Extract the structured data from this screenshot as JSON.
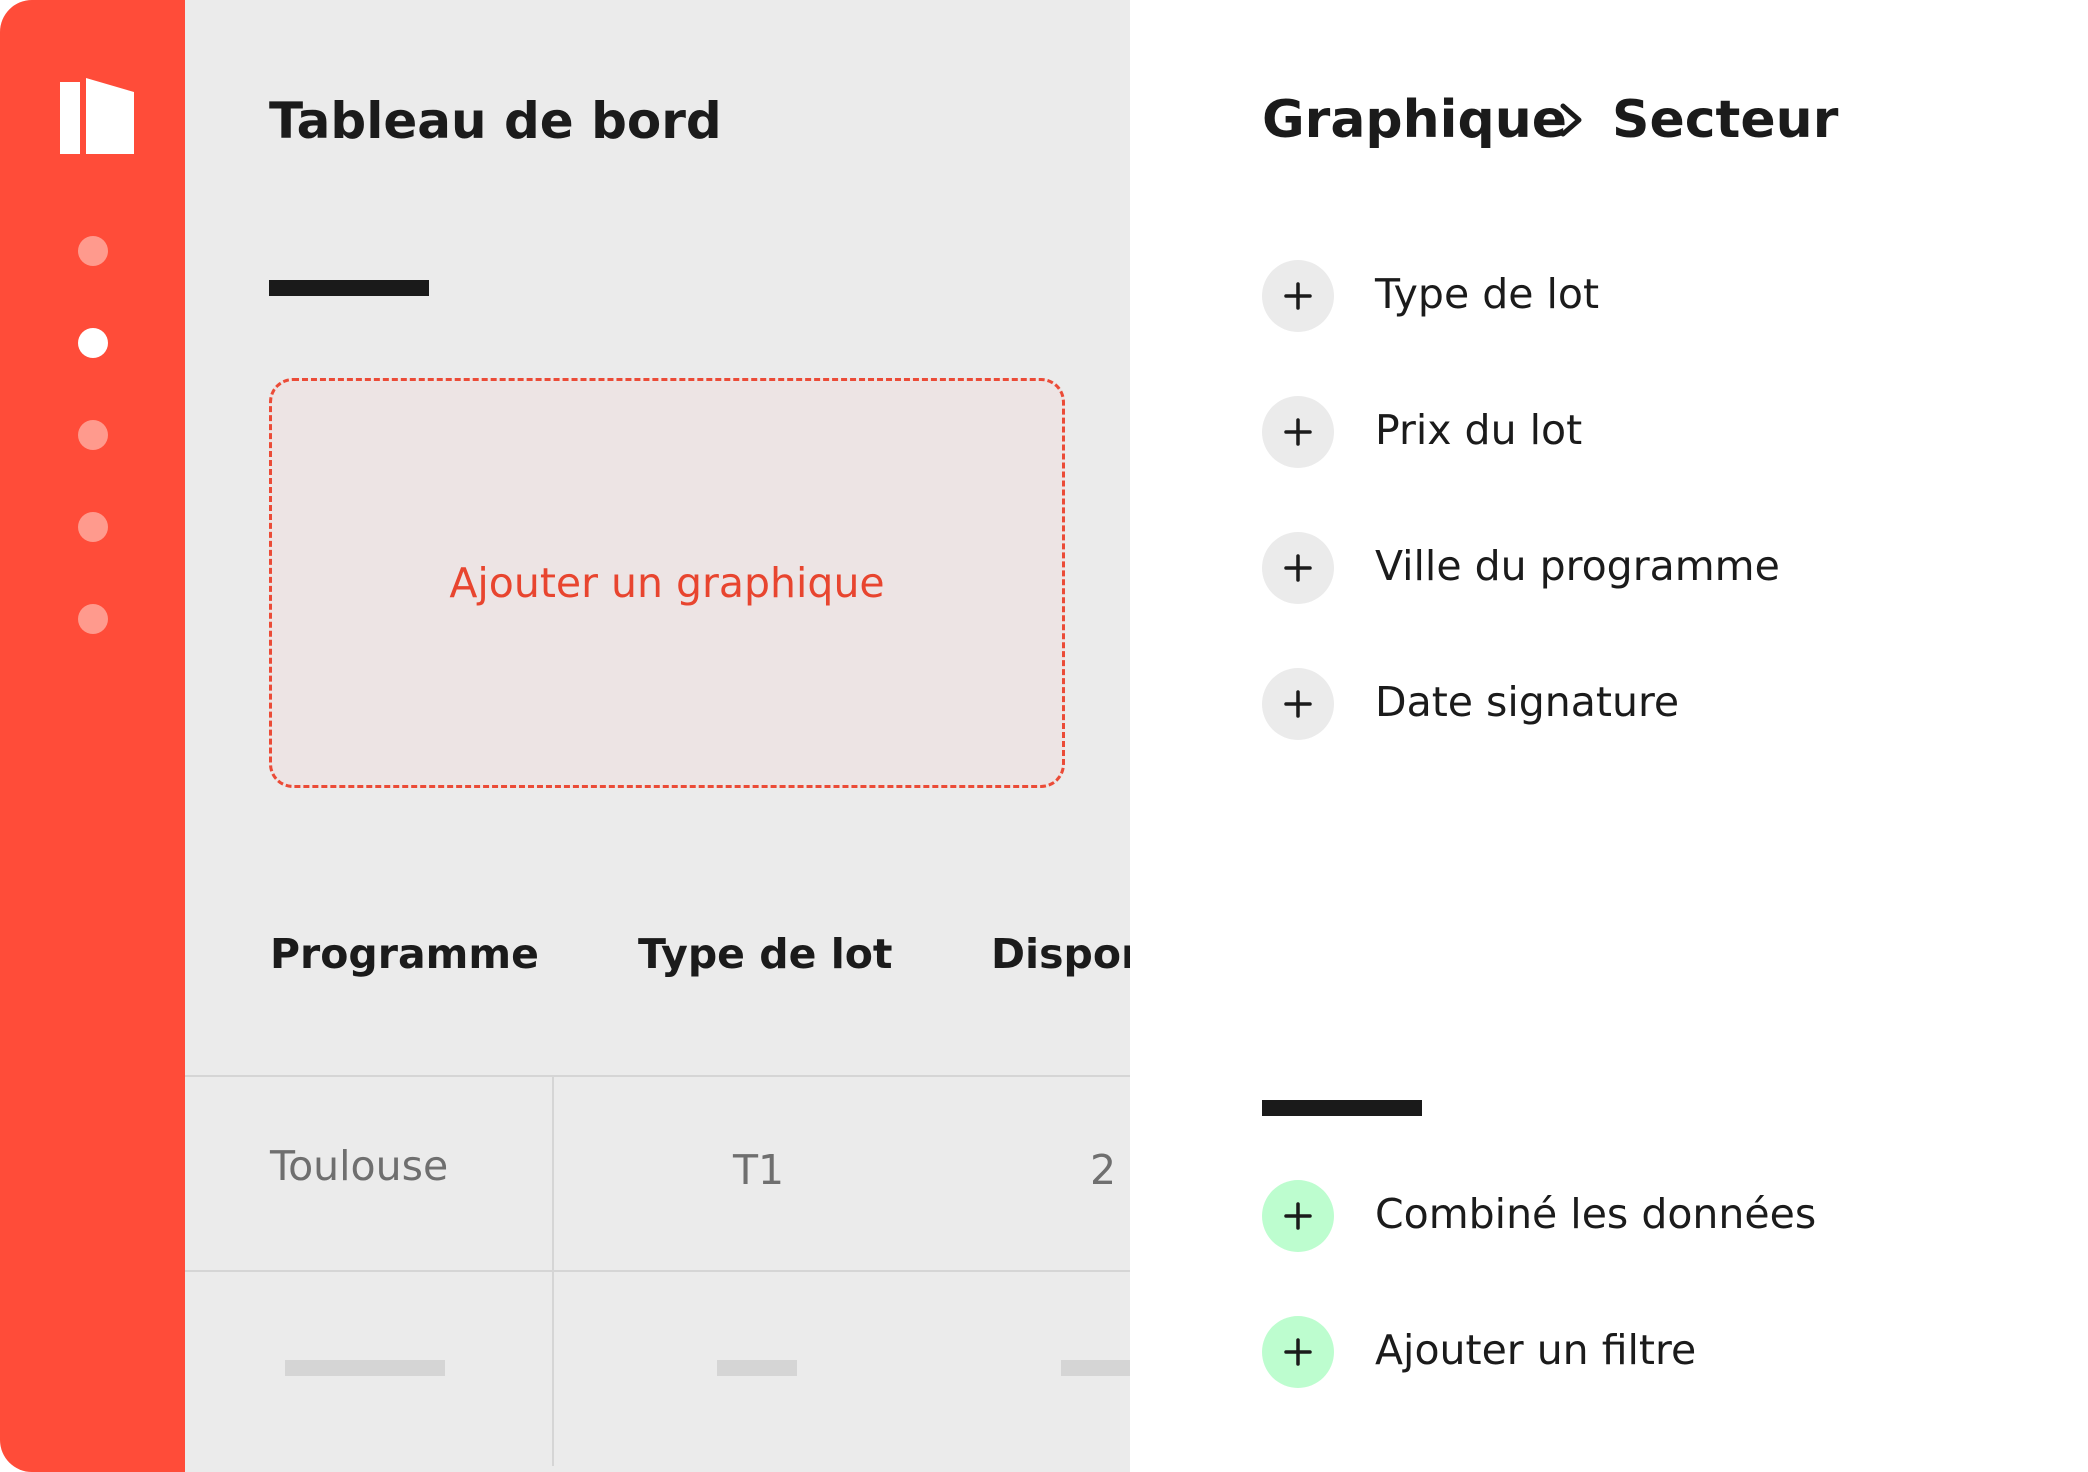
{
  "colors": {
    "sidebar": "#FF4C39",
    "accent": "#E8452F",
    "green_button": "#BDFDCF",
    "main_bg": "#EBEBEB"
  },
  "sidebar": {
    "logo_icon": "building-logo-icon",
    "nav_dots": [
      "inactive",
      "active",
      "inactive",
      "inactive",
      "inactive"
    ]
  },
  "main": {
    "title": "Tableau de bord",
    "add_chart_label": "Ajouter un graphique",
    "table": {
      "columns": [
        "Programme",
        "Type de lot",
        "Dispon"
      ],
      "rows": [
        [
          "Toulouse",
          "T1",
          "2"
        ]
      ]
    }
  },
  "panel": {
    "breadcrumb": {
      "parent": "Graphique",
      "separator_icon": "chevron-right-icon",
      "current": "Secteur"
    },
    "fields": [
      {
        "label": "Type de lot",
        "icon": "plus-icon"
      },
      {
        "label": "Prix du lot",
        "icon": "plus-icon"
      },
      {
        "label": "Ville du programme",
        "icon": "plus-icon"
      },
      {
        "label": "Date signature",
        "icon": "plus-icon"
      }
    ],
    "actions": [
      {
        "label": "Combiné les données",
        "icon": "plus-icon"
      },
      {
        "label": "Ajouter un filtre",
        "icon": "plus-icon"
      }
    ]
  }
}
